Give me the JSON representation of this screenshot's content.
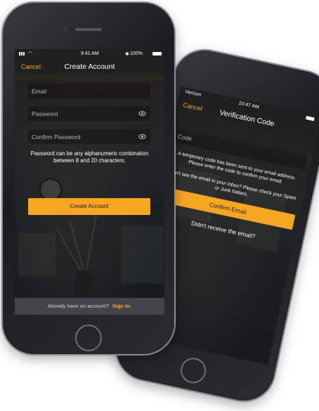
{
  "back_phone": {
    "status": {
      "carrier": "Verizon",
      "time": "10:47 AM"
    },
    "nav": {
      "cancel_label": "Cancel",
      "title": "Verification Code"
    },
    "code_field": {
      "placeholder": "Code"
    },
    "message_1": "A temporary code has been sent to your email address. Please enter the code to confirm your email.",
    "message_2": "Don't see the email in your inbox? Please check your Spam or Junk folders.",
    "confirm_button_label": "Confirm Email",
    "resend_link": "Didn't receive the email?"
  },
  "front_phone": {
    "status": {
      "time": "9:41 AM",
      "battery": "100%"
    },
    "nav": {
      "cancel_label": "Cancel",
      "title": "Create Account"
    },
    "fields": {
      "email_placeholder": "Email",
      "password_placeholder": "Password",
      "confirm_password_placeholder": "Confirm Password"
    },
    "hint": "Password can be any alphanumeric combination between 8 and 20 characters.",
    "create_button_label": "Create Account",
    "footer": {
      "prompt": "Already have an account?",
      "signin_label": "Sign In."
    }
  },
  "colors": {
    "accent": "#f5a623"
  }
}
